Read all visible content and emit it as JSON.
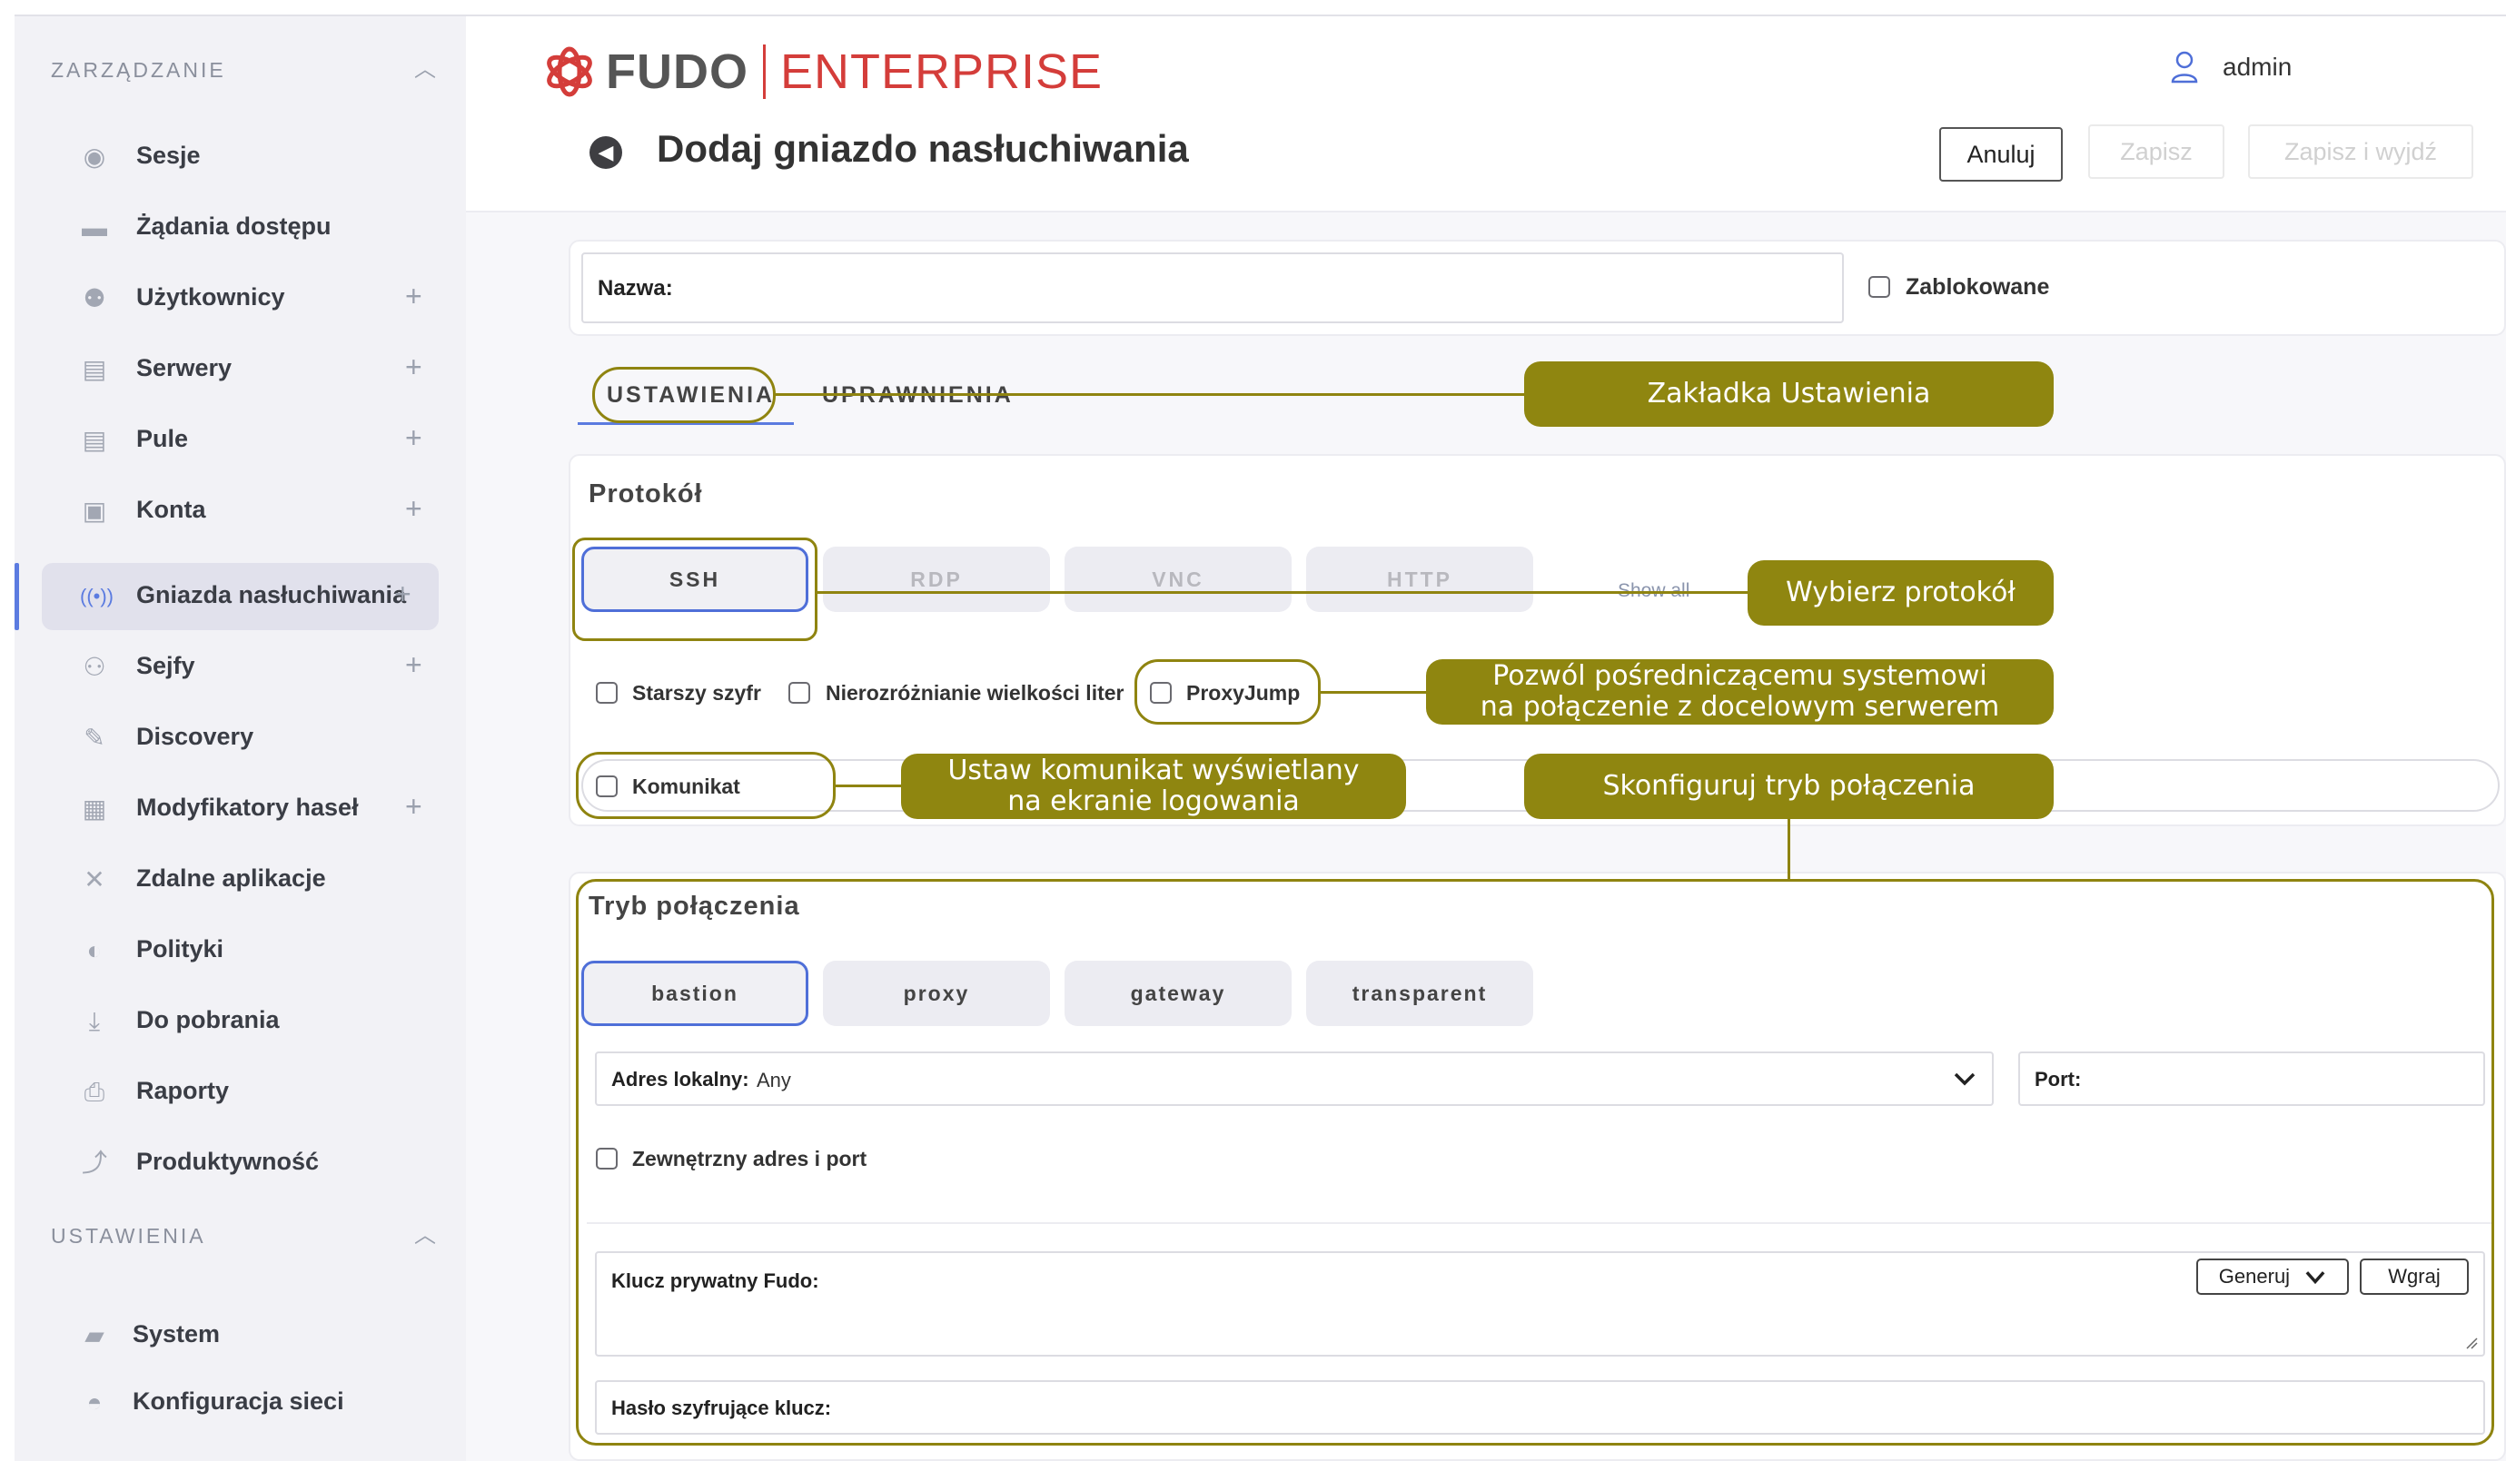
{
  "app": {
    "logo_primary": "FUDO",
    "logo_secondary": "ENTERPRISE",
    "brand_color": "#d43d3a",
    "accent_color": "#5b7be0",
    "callout_color": "#8f8610"
  },
  "user": {
    "name": "admin",
    "icon": "user-icon"
  },
  "sidebar": {
    "section_management": "ZARZĄDZANIE",
    "items": [
      {
        "label": "Sesje",
        "icon": "sessions-icon",
        "plus": ""
      },
      {
        "label": "Żądania dostępu",
        "icon": "access-requests-icon",
        "plus": ""
      },
      {
        "label": "Użytkownicy",
        "icon": "users-icon",
        "plus": "+"
      },
      {
        "label": "Serwery",
        "icon": "servers-icon",
        "plus": "+"
      },
      {
        "label": "Pule",
        "icon": "pools-icon",
        "plus": "+"
      },
      {
        "label": "Konta",
        "icon": "accounts-icon",
        "plus": "+"
      },
      {
        "label": "Gniazda nasłuchiwania",
        "icon": "listener-icon",
        "plus": "+"
      },
      {
        "label": "Sejfy",
        "icon": "safes-icon",
        "plus": "+"
      },
      {
        "label": "Discovery",
        "icon": "discovery-icon",
        "plus": ""
      },
      {
        "label": "Modyfikatory haseł",
        "icon": "password-changers-icon",
        "plus": "+"
      },
      {
        "label": "Zdalne aplikacje",
        "icon": "remote-apps-icon",
        "plus": ""
      },
      {
        "label": "Polityki",
        "icon": "policies-icon",
        "plus": ""
      },
      {
        "label": "Do pobrania",
        "icon": "download-icon",
        "plus": ""
      },
      {
        "label": "Raporty",
        "icon": "reports-icon",
        "plus": ""
      },
      {
        "label": "Produktywność",
        "icon": "productivity-icon",
        "plus": ""
      }
    ],
    "section_settings": "USTAWIENIA",
    "settings_items": [
      {
        "label": "System",
        "icon": "folder-icon"
      },
      {
        "label": "Konfiguracja sieci",
        "icon": "network-icon"
      }
    ]
  },
  "header": {
    "title": "Dodaj gniazdo nasłuchiwania",
    "cancel": "Anuluj",
    "save": "Zapisz",
    "save_exit": "Zapisz i wyjdź"
  },
  "form": {
    "name_label": "Nazwa:",
    "blocked_label": "Zablokowane",
    "tabs": [
      "USTAWIENIA",
      "UPRAWNIENIA"
    ],
    "protocol_title": "Protokół",
    "protocols": [
      "SSH",
      "RDP",
      "VNC",
      "HTTP"
    ],
    "show_all": "Show all",
    "option_legacy": "Starszy szyfr",
    "option_case": "Nierozróżnianie wielkości liter",
    "option_proxyjump": "ProxyJump",
    "option_message": "Komunikat",
    "mode_title": "Tryb połączenia",
    "modes": [
      "bastion",
      "proxy",
      "gateway",
      "transparent"
    ],
    "local_address_label": "Adres lokalny:",
    "local_address_value": "Any",
    "port_label": "Port:",
    "external_label": "Zewnętrzny adres i port",
    "private_key_label": "Klucz prywatny Fudo:",
    "generate": "Generuj",
    "upload": "Wgraj",
    "key_password_label": "Hasło szyfrujące klucz:"
  },
  "callouts": {
    "settings_tab": "Zakładka Ustawienia",
    "choose_protocol": "Wybierz protokół",
    "proxyjump_line1": "Pozwól pośredniczącemu systemowi",
    "proxyjump_line2": "na połączenie z docelowym serwerem",
    "message_line1": "Ustaw komunikat wyświetlany",
    "message_line2": "na ekranie logowania",
    "mode": "Skonfiguruj tryb połączenia"
  }
}
